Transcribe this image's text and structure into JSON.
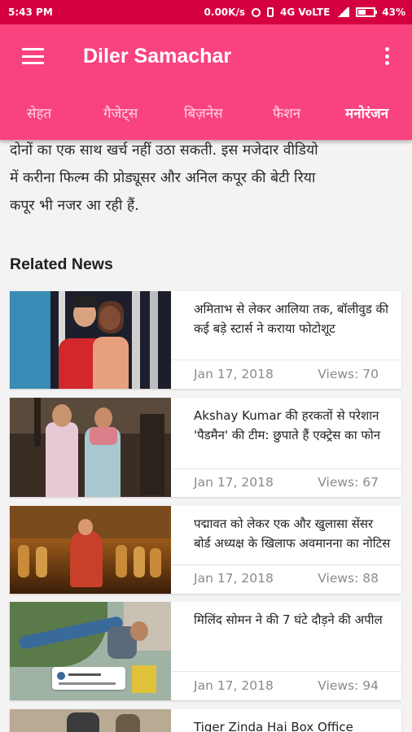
{
  "status_bar": {
    "time": "5:43 PM",
    "speed": "0.00K/s",
    "network": "4G VoLTE",
    "battery": "43%"
  },
  "app_bar": {
    "title": "Diler Samachar",
    "menu_icon": "hamburger-menu-icon",
    "overflow_icon": "more-vert-icon"
  },
  "tabs": [
    {
      "label": "सेहत",
      "active": false
    },
    {
      "label": "गैजेट्स",
      "active": false
    },
    {
      "label": "बिज़नेस",
      "active": false
    },
    {
      "label": "फैशन",
      "active": false
    },
    {
      "label": "मनोरंजन",
      "active": true
    }
  ],
  "article": {
    "lines": [
      "दोनों का एक साथ खर्च नहीं उठा सकती. इस मजेदार वीडियो",
      "में करीना फिल्म की प्रोड्यूसर और अनिल कपूर की बेटी रिया",
      "कपूर भी नजर आ रही हैं."
    ]
  },
  "related": {
    "heading": "Related News",
    "items": [
      {
        "headline": "अमिताभ से लेकर आलिया तक, बॉलीवुड की कई बड़े स्टार्स ने कराया फोटोशूट",
        "date": "Jan 17, 2018",
        "views": "Views: 70"
      },
      {
        "headline": "Akshay Kumar की हरकतों से परेशान 'पैडमैन' की टीम: छुपाते हैं एक्ट्रेस का फोन",
        "date": "Jan 17, 2018",
        "views": "Views: 67"
      },
      {
        "headline": "पद्मावत को लेकर एक और खुलासा सेंसर बोर्ड अध्यक्ष के खिलाफ अवमानना का नोटिस",
        "date": "Jan 17, 2018",
        "views": "Views: 88"
      },
      {
        "headline": "मिलिंद सोमन ने की 7 घंटे दौड़ने की अपील",
        "date": "Jan 17, 2018",
        "views": "Views: 94"
      },
      {
        "headline": "Tiger Zinda Hai Box Office",
        "date": "",
        "views": ""
      }
    ]
  },
  "colors": {
    "status_bar": "#d5003f",
    "app_bar": "#f9437f",
    "background": "#f4f3f3"
  }
}
